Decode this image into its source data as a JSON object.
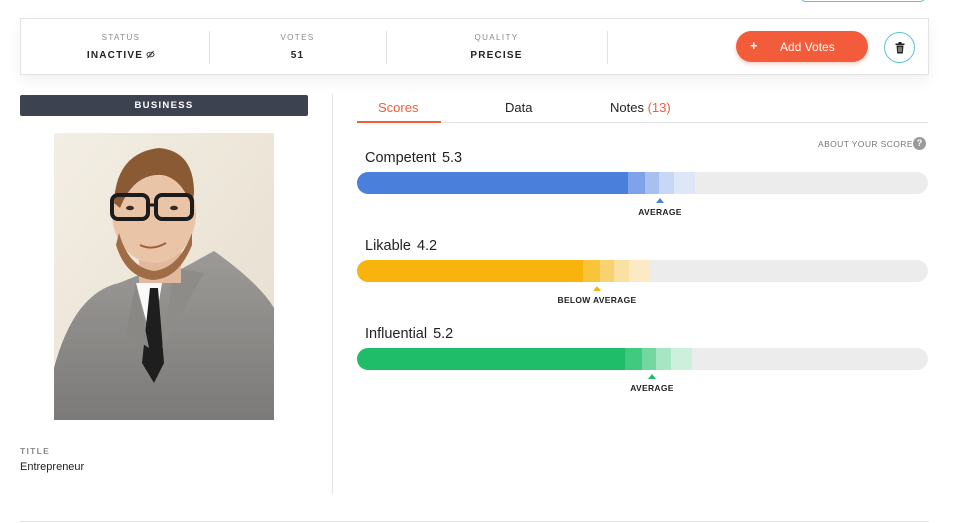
{
  "status_card": {
    "status": {
      "label": "STATUS",
      "value": "INACTIVE"
    },
    "votes": {
      "label": "VOTES",
      "value": "51"
    },
    "quality": {
      "label": "QUALITY",
      "value": "PRECISE"
    },
    "add_votes": {
      "icon": "+",
      "label": "Add Votes"
    }
  },
  "profile": {
    "category": "BUSINESS",
    "title_label": "TITLE",
    "title_value": "Entrepreneur"
  },
  "tabs": {
    "scores": "Scores",
    "data": "Data",
    "notes": "Notes",
    "notes_count": "(13)"
  },
  "about_scores": "ABOUT YOUR SCORES",
  "help_icon": "?",
  "scores": [
    {
      "name": "Competent",
      "value": "5.3",
      "fill_fraction": 0.475,
      "marker_fraction": 0.53,
      "verdict": "AVERAGE",
      "color": "#4a7fdc",
      "fade": [
        "#7fa3e8",
        "#a7c0ef",
        "#c8d7f5",
        "#dde7f8"
      ]
    },
    {
      "name": "Likable",
      "value": "4.2",
      "fill_fraction": 0.395,
      "marker_fraction": 0.42,
      "verdict": "BELOW AVERAGE",
      "color": "#f8b40c",
      "fade": [
        "#f8c43a",
        "#f9d270",
        "#fbe0a4",
        "#fde9c4"
      ]
    },
    {
      "name": "Influential",
      "value": "5.2",
      "fill_fraction": 0.47,
      "marker_fraction": 0.517,
      "verdict": "AVERAGE",
      "color": "#1fbd6a",
      "fade": [
        "#3fca80",
        "#73d8a0",
        "#a7e6c2",
        "#cdf0dc"
      ]
    }
  ]
}
